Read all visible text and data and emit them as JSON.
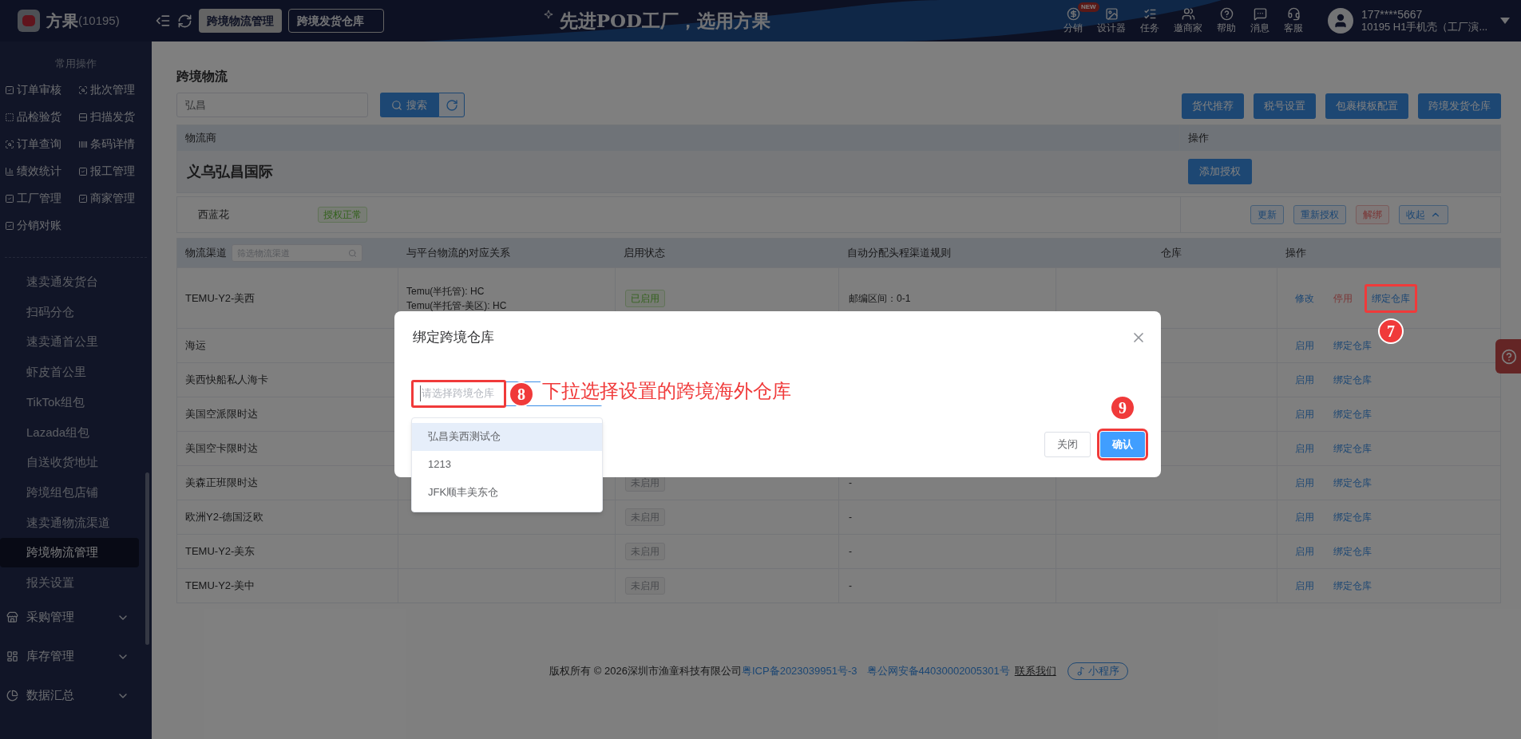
{
  "topbar": {
    "brand": "方果",
    "brand_count": "(10195)",
    "tabs": [
      {
        "label": "跨境物流管理",
        "selected": true
      },
      {
        "label": "跨境发货仓库",
        "selected": false
      }
    ],
    "slogan": "先进POD工厂，选用方果",
    "nav": [
      {
        "label": "分销",
        "badge": "NEW"
      },
      {
        "label": "设计器"
      },
      {
        "label": "任务"
      },
      {
        "label": "邀商家"
      },
      {
        "label": "帮助"
      },
      {
        "label": "消息"
      },
      {
        "label": "客服"
      }
    ],
    "user": {
      "phone": "177****5667",
      "account": "10195  H1手机壳（工厂演..."
    }
  },
  "sidebar": {
    "section_title": "常用操作",
    "shortcuts": [
      "订单审核",
      "批次管理",
      "品检验货",
      "扫描发货",
      "订单查询",
      "条码详情",
      "绩效统计",
      "报工管理",
      "工厂管理",
      "商家管理",
      "分销对账"
    ],
    "items": [
      {
        "label": "速卖通发货台",
        "selected": false
      },
      {
        "label": "扫码分仓",
        "selected": false
      },
      {
        "label": "速卖通首公里",
        "selected": false
      },
      {
        "label": "虾皮首公里",
        "selected": false
      },
      {
        "label": "TikTok组包",
        "selected": false
      },
      {
        "label": "Lazada组包",
        "selected": false
      },
      {
        "label": "自送收货地址",
        "selected": false
      },
      {
        "label": "跨境组包店铺",
        "selected": false
      },
      {
        "label": "速卖通物流渠道",
        "selected": false
      },
      {
        "label": "跨境物流管理",
        "selected": true
      },
      {
        "label": "报关设置",
        "selected": false
      }
    ],
    "groups": [
      {
        "label": "采购管理",
        "expanded": false
      },
      {
        "label": "库存管理",
        "expanded": false
      },
      {
        "label": "数据汇总",
        "expanded": false
      }
    ]
  },
  "page": {
    "title": "跨境物流",
    "search": {
      "value": "弘昌",
      "button": "搜索"
    },
    "actions": [
      "货代推荐",
      "税号设置",
      "包裹模板配置",
      "跨境发货仓库"
    ],
    "provider_table": {
      "columns": [
        "物流商",
        "操作"
      ],
      "provider": "义乌弘昌国际",
      "add_button": "添加授权",
      "account": {
        "name": "西蓝花",
        "status": "授权正常",
        "buttons": [
          {
            "label": "更新",
            "kind": "normal"
          },
          {
            "label": "重新授权",
            "kind": "normal"
          },
          {
            "label": "解绑",
            "kind": "danger"
          },
          {
            "label": "收起",
            "kind": "collapse"
          }
        ]
      }
    },
    "channel_table": {
      "filter_placeholder": "筛选物流渠道",
      "columns": [
        "物流渠道",
        "与平台物流的对应关系",
        "启用状态",
        "自动分配头程渠道规则",
        "仓库",
        "操作"
      ],
      "rows": [
        {
          "name": "TEMU-Y2-美西",
          "mappings": [
            "Temu(半托管): HC",
            "Temu(半托管-美区): HC"
          ],
          "status": "已启用",
          "enabled": true,
          "rule": "邮编区间：0-1",
          "actions": [
            {
              "label": "修改",
              "kind": "edit"
            },
            {
              "label": "停用",
              "kind": "disable"
            },
            {
              "label": "绑定仓库",
              "kind": "bind",
              "annotation": "7"
            }
          ]
        },
        {
          "name": "海运",
          "actions": [
            {
              "label": "启用",
              "kind": "enable"
            },
            {
              "label": "绑定仓库",
              "kind": "bind"
            }
          ]
        },
        {
          "name": "美西快船私人海卡",
          "actions": [
            {
              "label": "启用",
              "kind": "enable"
            },
            {
              "label": "绑定仓库",
              "kind": "bind"
            }
          ]
        },
        {
          "name": "美国空派限时达",
          "actions": [
            {
              "label": "启用",
              "kind": "enable"
            },
            {
              "label": "绑定仓库",
              "kind": "bind"
            }
          ]
        },
        {
          "name": "美国空卡限时达",
          "actions": [
            {
              "label": "启用",
              "kind": "enable"
            },
            {
              "label": "绑定仓库",
              "kind": "bind"
            }
          ]
        },
        {
          "name": "美森正班限时达",
          "status": "未启用",
          "enabled": false,
          "rule": "-",
          "actions": [
            {
              "label": "启用",
              "kind": "enable"
            },
            {
              "label": "绑定仓库",
              "kind": "bind"
            }
          ]
        },
        {
          "name": "欧洲Y2-德国泛欧",
          "status": "未启用",
          "enabled": false,
          "rule": "-",
          "actions": [
            {
              "label": "启用",
              "kind": "enable"
            },
            {
              "label": "绑定仓库",
              "kind": "bind"
            }
          ]
        },
        {
          "name": "TEMU-Y2-美东",
          "status": "未启用",
          "enabled": false,
          "rule": "-",
          "actions": [
            {
              "label": "启用",
              "kind": "enable"
            },
            {
              "label": "绑定仓库",
              "kind": "bind"
            }
          ]
        },
        {
          "name": "TEMU-Y2-美中",
          "status": "未启用",
          "enabled": false,
          "rule": "-",
          "actions": [
            {
              "label": "启用",
              "kind": "enable"
            },
            {
              "label": "绑定仓库",
              "kind": "bind"
            }
          ]
        }
      ]
    }
  },
  "footer": {
    "copyright": "版权所有 © 2026深圳市渔童科技有限公司",
    "icp": "粤ICP备2023039951号-3",
    "police": "粤公网安备44030002005301号",
    "contact": "联系我们",
    "mini_program": "小程序"
  },
  "modal": {
    "title": "绑定跨境仓库",
    "select": {
      "placeholder": "请选择跨境仓库",
      "annotation": "8",
      "annotation_note": "下拉选择设置的跨境海外仓库"
    },
    "options": [
      {
        "label": "弘昌美西测试仓",
        "selected": true
      },
      {
        "label": "1213",
        "selected": false
      },
      {
        "label": "JFK顺丰美东仓",
        "selected": false
      }
    ],
    "buttons": [
      {
        "label": "关闭",
        "kind": "secondary"
      },
      {
        "label": "确认",
        "kind": "primary",
        "annotation": "9"
      }
    ]
  }
}
